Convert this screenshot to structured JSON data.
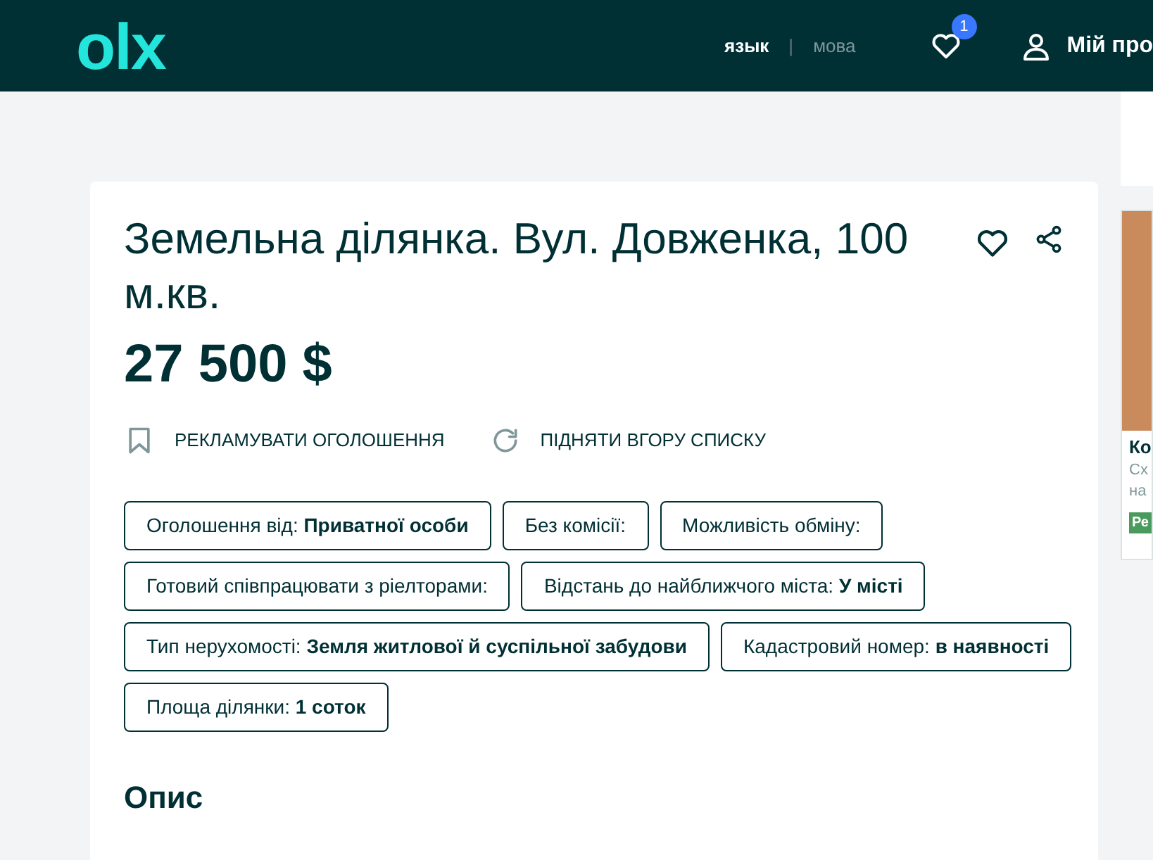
{
  "header": {
    "logo": "olx",
    "languages": [
      {
        "label": "язык",
        "selected": true
      },
      {
        "label": "мова",
        "selected": false
      }
    ],
    "language_separator": "|",
    "favorites_count": "1",
    "account_label": "Мій про"
  },
  "listing": {
    "title": "Земельна ділянка. Вул. Довженка, 100 м.кв.",
    "price": "27 500 $",
    "actions": [
      {
        "kind": "promote",
        "label": "РЕКЛАМУВАТИ ОГОЛОШЕННЯ"
      },
      {
        "kind": "refresh",
        "label": "ПІДНЯТИ ВГОРУ СПИСКУ"
      }
    ],
    "tags": [
      {
        "label": "Оголошення від:",
        "value": "Приватної особи"
      },
      {
        "label": "Без комісії:"
      },
      {
        "label": "Можливість обміну:"
      },
      {
        "label": "Готовий співпрацювати з ріелторами:"
      },
      {
        "label": "Відстань до найближчого міста:",
        "value": "У місті"
      },
      {
        "label": "Тип нерухомості:",
        "value": "Земля житлової й суспільної забудови"
      },
      {
        "label": "Кадастровий номер:",
        "value": "в наявності"
      },
      {
        "label": "Площа ділянки:",
        "value": "1 соток"
      }
    ],
    "description_heading": "Опис"
  },
  "ad": {
    "title": "Ко",
    "line_1": "Сх",
    "line_2": "на",
    "badge": "Ре"
  }
}
